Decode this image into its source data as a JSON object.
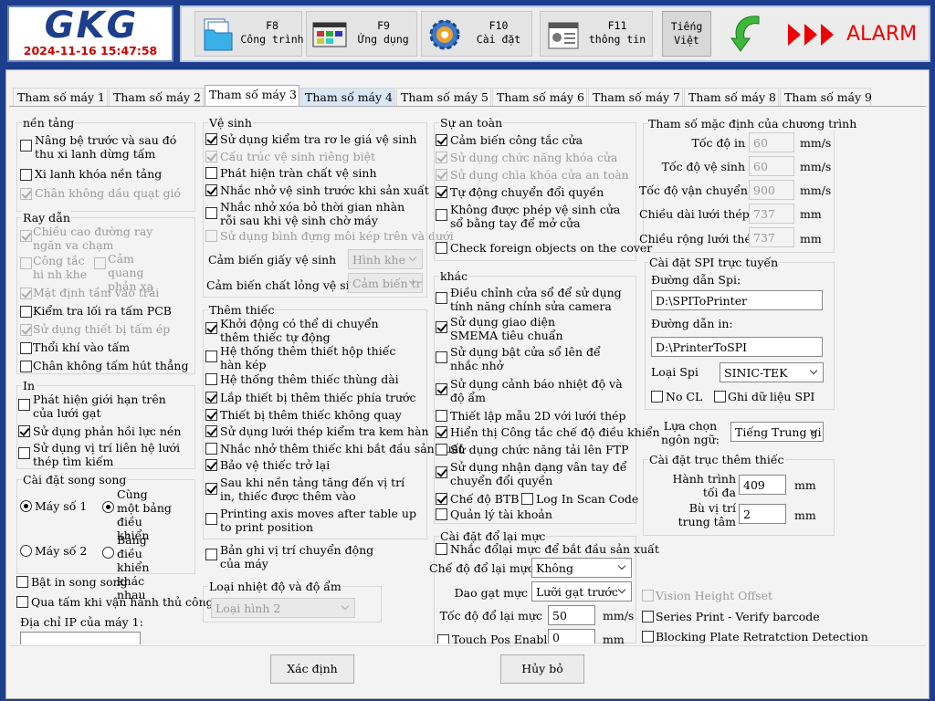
{
  "header": {
    "logo": "GKG",
    "datetime": "2024-11-16 15:47:58",
    "buttons": [
      {
        "key": "F8",
        "label": "Công trình"
      },
      {
        "key": "F9",
        "label": "Ứng dụng"
      },
      {
        "key": "F10",
        "label": "Cài đặt"
      },
      {
        "key": "F11",
        "label": "thông tin"
      }
    ],
    "language": {
      "line1": "Tiếng",
      "line2": "Việt"
    },
    "alarm": "ALARM"
  },
  "tabs": [
    "Tham số máy 1",
    "Tham số máy 2",
    "Tham số máy 3",
    "Tham số máy 4",
    "Tham số máy 5",
    "Tham số máy 6",
    "Tham số máy 7",
    "Tham số máy 8",
    "Tham số máy 9"
  ],
  "col1": {
    "platform_title": "nền tảng",
    "platform": [
      {
        "label": "Nâng bệ trước và sau đó thu xi lanh dừng tấm",
        "checked": false,
        "disabled": false
      },
      {
        "label": "Xi lanh khóa nền tảng",
        "checked": false,
        "disabled": false
      },
      {
        "label": "Chân không dầu quạt gió",
        "checked": true,
        "disabled": true
      }
    ],
    "rail_title": "Ray dẫn",
    "rail": [
      {
        "label": "Chiều cao đường ray ngăn va chạm",
        "checked": true,
        "disabled": true
      },
      {
        "label": "Công tắc hi nh khe",
        "checked": false,
        "disabled": true
      },
      {
        "label": "Cảm quang phản xạ",
        "checked": false,
        "disabled": true
      },
      {
        "label": "Mặt định tầm vào trái",
        "checked": true,
        "disabled": true
      },
      {
        "label": "Kiểm tra lối ra tấm PCB",
        "checked": false,
        "disabled": false
      },
      {
        "label": "Sử dụng thiết bị tấm ép",
        "checked": true,
        "disabled": true
      },
      {
        "label": "Thổi khí vào tấm",
        "checked": false,
        "disabled": false
      },
      {
        "label": "Chân không tấm hút thẳng",
        "checked": false,
        "disabled": false
      }
    ],
    "in_title": "In",
    "in": [
      {
        "label": "Phát hiện giới hạn trên của lưới gạt",
        "checked": false
      },
      {
        "label": "Sử dụng phản hồi lực nén",
        "checked": true
      },
      {
        "label": "Sử dụng vị trí liên hệ lưới thép tìm kiếm",
        "checked": false
      }
    ],
    "dual_title": "Cài đặt song song",
    "radios": [
      {
        "label": "Máy số 1",
        "checked": true
      },
      {
        "label": "Cùng một bảng điều khiển",
        "checked": true
      },
      {
        "label": "Máy số 2",
        "checked": false
      },
      {
        "label": "Bảng điều khiển khác nhau",
        "checked": false
      }
    ],
    "dual_print": {
      "label": "Bật in song song",
      "checked": false
    },
    "manual": {
      "label": "Qua tấm khi vận hành thủ công",
      "checked": false
    },
    "ip_label": "Địa chỉ IP của máy 1:",
    "ip_value": ""
  },
  "col2": {
    "clean_title": "Vệ sinh",
    "clean": [
      {
        "label": "Sử dụng kiểm tra rơ le giá vệ sinh",
        "checked": true,
        "disabled": false
      },
      {
        "label": "Cấu trúc vệ sinh riêng biệt",
        "checked": true,
        "disabled": true
      },
      {
        "label": "Phát hiện tràn chất vệ sinh",
        "checked": false,
        "disabled": false
      },
      {
        "label": "Nhắc nhở vệ sinh trước khi sản xuất",
        "checked": true,
        "disabled": false
      },
      {
        "label": "Nhắc nhở xóa bỏ thời gian nhàn rỗi sau khi vệ sinh chờ máy",
        "checked": false,
        "disabled": false
      },
      {
        "label": "Sử dụng bình đựng môi kép trên và dưới",
        "checked": false,
        "disabled": true
      }
    ],
    "paper_sensor_label": "Cảm biến giấy vệ sinh",
    "paper_sensor_value": "Hình khe",
    "liquid_sensor_label": "Cảm biến chất lỏng vệ sinh",
    "liquid_sensor_value": "Cảm biến tr",
    "addon_title": "Thêm thiếc",
    "addon": [
      {
        "label": "Khởi động có thể di chuyển thêm thiếc tự động",
        "checked": true
      },
      {
        "label": "Hệ thống thêm thiết hộp thiếc hàn kép",
        "checked": false
      },
      {
        "label": "Hệ thống thêm thiếc thùng dài",
        "checked": false
      },
      {
        "label": "Lắp thiết bị thêm thiếc phía trước",
        "checked": true
      },
      {
        "label": "Thiết bị thêm thiếc không quay",
        "checked": true
      },
      {
        "label": "Sử dụng lưới thép kiểm tra kem hàn",
        "checked": true
      },
      {
        "label": "Nhắc nhở thêm thiếc khi bắt đầu sản xuất",
        "checked": false
      },
      {
        "label": "Bảo vệ thiếc trở lại",
        "checked": true
      },
      {
        "label": "Sau khi nền tảng tăng đến vị trí in, thiếc được thêm vào",
        "checked": true
      },
      {
        "label": "Printing axis moves after table up to print position",
        "checked": false
      }
    ],
    "record": {
      "label": "Bản ghi vị trí chuyển động của máy",
      "checked": false
    },
    "temp_title": "Loại nhiệt độ và độ ẩm",
    "temp_value": "Loại hình 2"
  },
  "col3": {
    "safety_title": "Sự an toàn",
    "safety": [
      {
        "label": "Cảm biến công tắc cửa",
        "checked": true,
        "disabled": false
      },
      {
        "label": "Sử dụng chức năng khóa cửa",
        "checked": true,
        "disabled": true
      },
      {
        "label": "Sử dụng chìa khóa cửa an toàn",
        "checked": true,
        "disabled": true
      },
      {
        "label": "Tự động chuyển đổi quyền",
        "checked": true,
        "disabled": false
      },
      {
        "label": "Không được phép vệ sinh cửa sổ bằng tay để mở cửa",
        "checked": false,
        "disabled": false
      },
      {
        "label": "Check foreign objects on the cover",
        "checked": false,
        "disabled": false
      }
    ],
    "other_title": "khác",
    "other": [
      {
        "label": "Điều chỉnh cửa sổ để sử dụng tính năng chính sửa camera",
        "checked": false
      },
      {
        "label": "Sử dụng giao diện SMEMA tiêu chuẩn",
        "checked": true
      },
      {
        "label": "Sử dụng bật cửa sổ lên để nhắc nhở",
        "checked": false
      },
      {
        "label": "Sử dụng cảnh báo nhiệt độ và độ ẩm",
        "checked": true
      },
      {
        "label": "Thiết lập mẫu 2D với lưới thép",
        "checked": false
      },
      {
        "label": "Hiển thị Công tắc chế độ điều khiển",
        "checked": true
      },
      {
        "label": "Sử dụng chức năng tải lên FTP",
        "checked": false
      },
      {
        "label": "Sử dụng nhận dạng vân tay để chuyển đổi quyền",
        "checked": true
      },
      {
        "label": "Chế độ BTB",
        "checked": true
      },
      {
        "label": "Log In Scan Code",
        "checked": false
      },
      {
        "label": "Quản lý tài khoản",
        "checked": false
      }
    ],
    "refill_title": "Cài đặt đổ lại mực",
    "refill_remind": {
      "label": "Nhắc đổlại mực để bắt đầu sản xuất",
      "checked": false
    },
    "refill_mode_label": "Chế độ đổ lại mực",
    "refill_mode_value": "Không",
    "knife_label": "Dao gạt mực",
    "knife_value": "Lưỡi gạt trước",
    "speed_label": "Tốc độ đổ lại mực",
    "speed_value": "50",
    "speed_unit": "mm/s",
    "touch": {
      "label": "Touch Pos Enable",
      "checked": false
    },
    "touch_value": "0",
    "touch_unit": "mm"
  },
  "col4": {
    "defaults_title": "Tham số mặc định của chương trình",
    "defaults": [
      {
        "label": "Tốc độ in",
        "value": "60",
        "unit": "mm/s"
      },
      {
        "label": "Tốc độ vệ sinh",
        "value": "60",
        "unit": "mm/s"
      },
      {
        "label": "Tốc độ vận chuyển",
        "value": "900",
        "unit": "mm/s"
      },
      {
        "label": "Chiều dài lưới thép",
        "value": "737",
        "unit": "mm"
      },
      {
        "label": "Chiều rộng lưới thép",
        "value": "737",
        "unit": "mm"
      }
    ],
    "spi_title": "Cài đặt SPI trực tuyến",
    "spi_path_label": "Đường dẫn Spi:",
    "spi_path_value": "D:\\SPIToPrinter",
    "in_path_label": "Đường dẫn in:",
    "in_path_value": "D:\\PrinterToSPI",
    "spi_type_label": "Loại Spi",
    "spi_type_value": "SINIC-TEK",
    "no_cl": {
      "label": "No CL",
      "checked": false
    },
    "keep_spi": {
      "label": "Ghi dữ liệu SPI",
      "checked": false
    },
    "lang_label": "Lựa chọn ngôn ngữ:",
    "lang_value": "Tiếng Trung gi",
    "axis_title": "Cài đặt trục thêm thiếc",
    "stroke_label": "Hành trình tối đa",
    "stroke_value": "409",
    "stroke_unit": "mm",
    "center_label": "Bù vị trí trung tâm",
    "center_value": "2",
    "center_unit": "mm",
    "vision": {
      "label": "Vision Height Offset",
      "checked": false,
      "disabled": true
    },
    "series": {
      "label": "Series Print - Verify barcode",
      "checked": false
    },
    "blocking": {
      "label": "Blocking Plate Retratction Detection",
      "checked": false
    }
  },
  "footer": {
    "ok": "Xác định",
    "cancel": "Hủy bỏ"
  }
}
